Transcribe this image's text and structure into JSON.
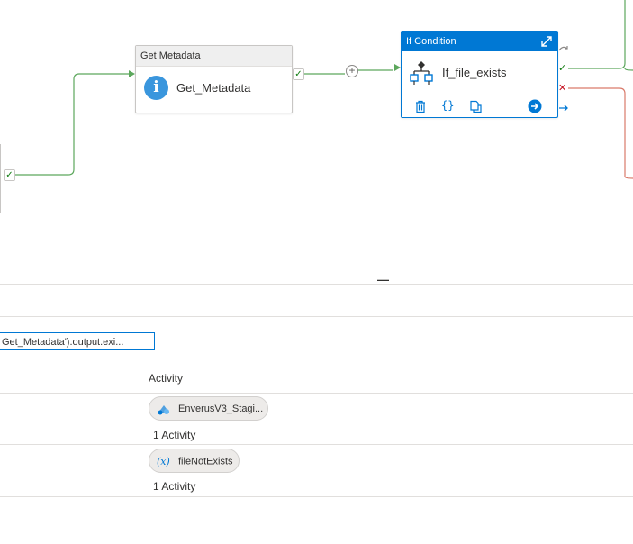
{
  "nodes": {
    "get_metadata": {
      "type_label": "Get Metadata",
      "name": "Get_Metadata",
      "icon": "info-icon"
    },
    "if_condition": {
      "type_label": "If Condition",
      "name": "If_file_exists",
      "icon": "if-condition-icon",
      "actions": [
        "delete-icon",
        "code-icon",
        "copy-icon",
        "navigate-icon"
      ]
    }
  },
  "wire_colors": {
    "success": "#5ca75c",
    "failure": "#d97a6a",
    "accent": "#0078d4"
  },
  "panel": {
    "minimize_glyph": "—",
    "expression_value": "Get_Metadata').output.exi...",
    "activity_header": "Activity",
    "cases": [
      {
        "activity_name": "EnverusV3_Stagi...",
        "icon": "copy-data-icon",
        "count_label": "1 Activity"
      },
      {
        "activity_name": "fileNotExists",
        "icon": "set-variable-icon",
        "icon_glyph": "(x)",
        "count_label": "1 Activity"
      }
    ]
  }
}
